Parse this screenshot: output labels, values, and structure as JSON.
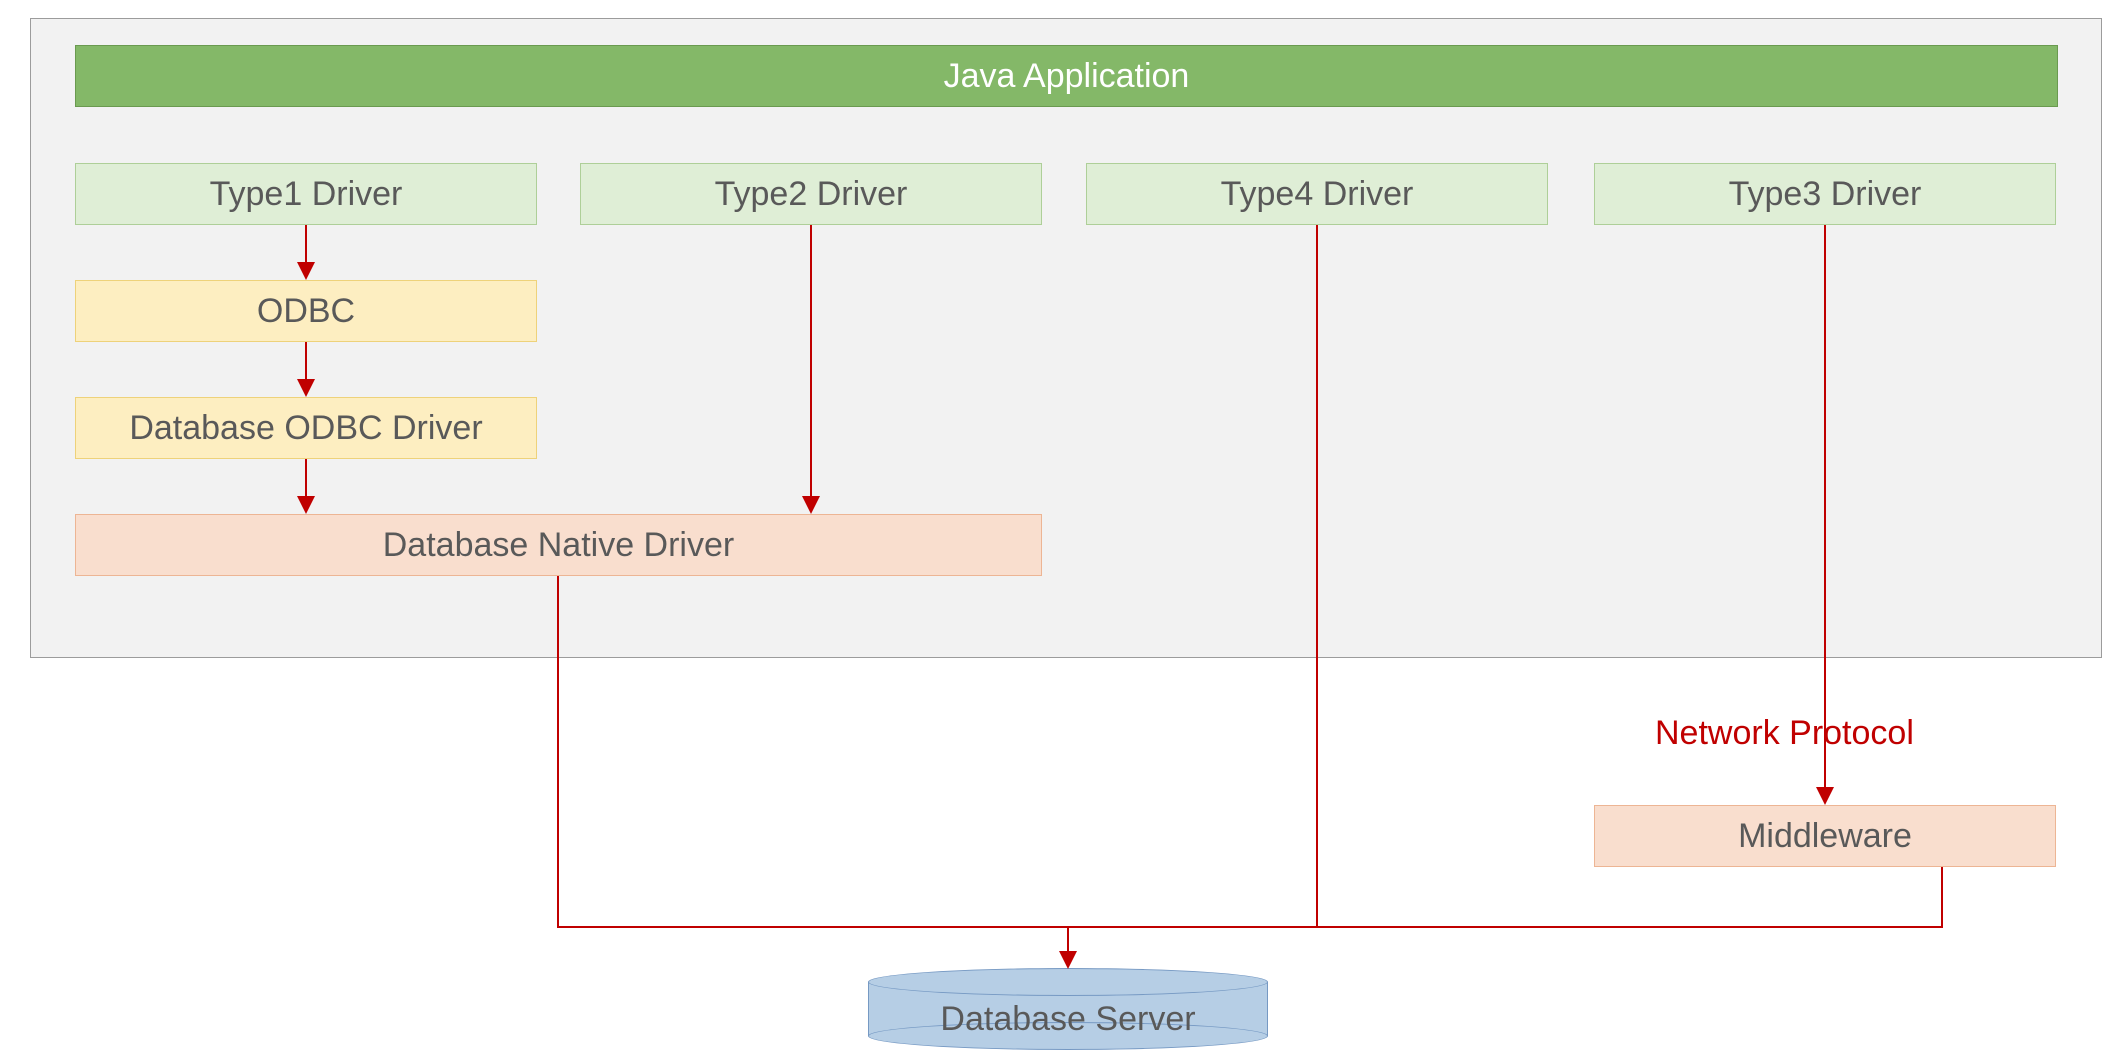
{
  "container": {
    "javaApplication": "Java Application",
    "type1": "Type1 Driver",
    "type2": "Type2 Driver",
    "type4": "Type4 Driver",
    "type3": "Type3 Driver",
    "odbc": "ODBC",
    "odbcDriver": "Database ODBC Driver",
    "nativeDriver": "Database Native Driver"
  },
  "external": {
    "networkProtocol": "Network Protocol",
    "middleware": "Middleware",
    "databaseServer": "Database Server"
  },
  "colors": {
    "arrow": "#c00000",
    "container_border": "#9c9c9c",
    "container_fill": "#f2f2f2",
    "green_header_fill": "#84b868",
    "green_header_border": "#6a9a50",
    "green_light_fill": "#dfeed6",
    "green_light_border": "#aecf98",
    "yellow_fill": "#fdeec1",
    "yellow_border": "#eed27a",
    "pink_fill": "#f9dece",
    "pink_border": "#edb594",
    "cylinder_fill": "#b6cee5",
    "cylinder_border": "#7699c3"
  },
  "diagram": {
    "edges": [
      {
        "from": "type1",
        "to": "odbc",
        "arrowhead": true
      },
      {
        "from": "odbc",
        "to": "odbcDriver",
        "arrowhead": true
      },
      {
        "from": "odbcDriver",
        "to": "nativeDriver",
        "arrowhead": true
      },
      {
        "from": "type2",
        "to": "nativeDriver",
        "arrowhead": true
      },
      {
        "from": "nativeDriver",
        "to": "databaseServer",
        "via": "bus",
        "arrowhead": false
      },
      {
        "from": "type4",
        "to": "databaseServer",
        "via": "bus",
        "arrowhead": false
      },
      {
        "from": "type3",
        "to": "middleware",
        "label": "networkProtocol",
        "arrowhead": true
      },
      {
        "from": "middleware",
        "to": "databaseServer",
        "via": "bus",
        "arrowhead": false
      },
      {
        "from": "bus",
        "to": "databaseServer",
        "arrowhead": true
      }
    ]
  }
}
